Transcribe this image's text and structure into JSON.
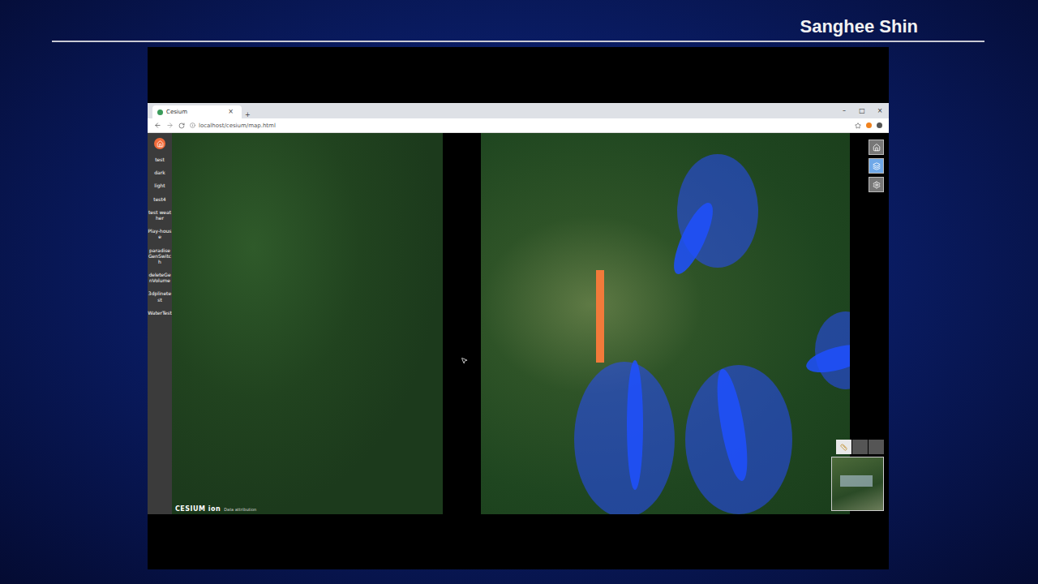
{
  "presenter": "Sanghee Shin",
  "browser": {
    "tab_title": "Cesium",
    "tab_close": "×",
    "new_tab": "+",
    "url": "localhost/cesium/map.html",
    "controls": [
      "–",
      "□",
      "×"
    ]
  },
  "sidebar": {
    "items": [
      "test",
      "dark",
      "light",
      "test4",
      "test weather",
      "Play-house",
      "paradiseGenSwitch",
      "deleteGenVolume",
      "3dplinetest",
      "WaterTest"
    ]
  },
  "map": {
    "credit": "CESIUM ion",
    "attribution": "Data attribution"
  }
}
